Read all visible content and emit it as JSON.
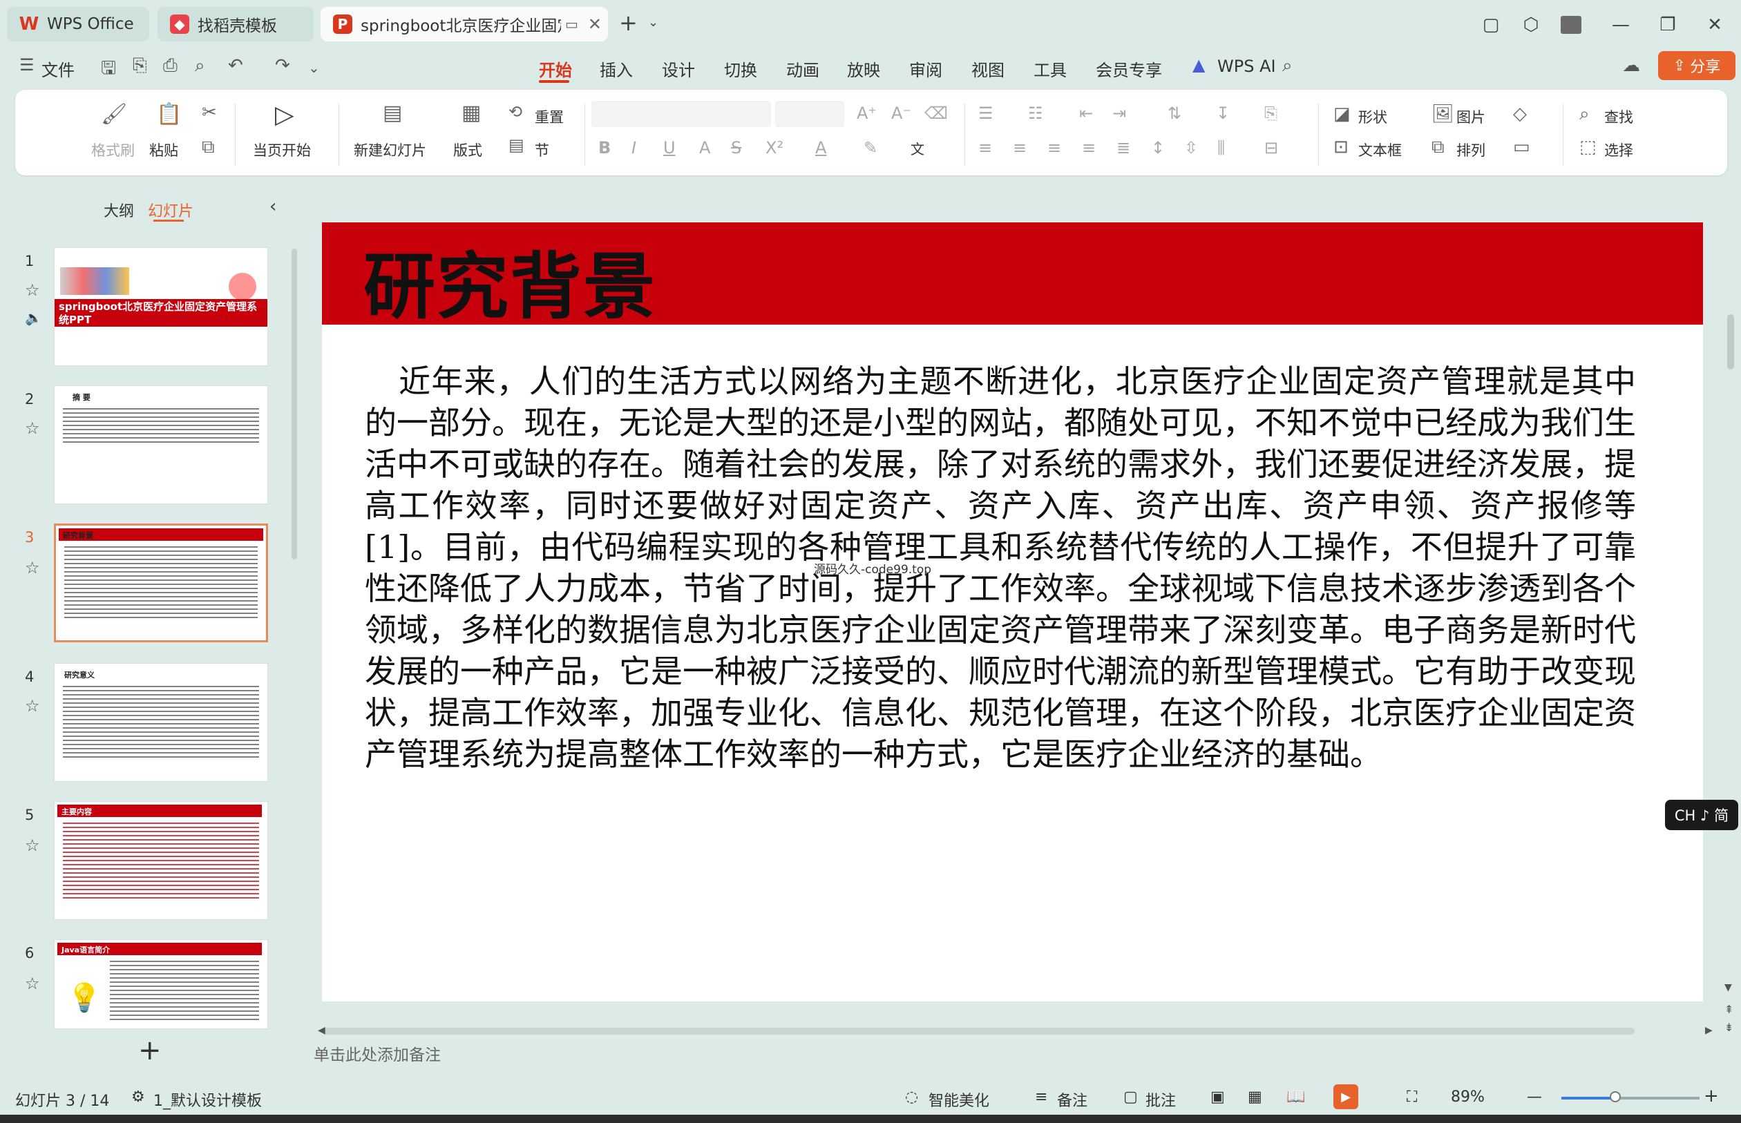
{
  "titlebar": {
    "tabs": [
      {
        "label": "WPS Office",
        "logo": "W"
      },
      {
        "label": "找稻壳模板",
        "logo": "◆"
      },
      {
        "label": "springboot北京医疗企业固定",
        "logo": "P"
      }
    ],
    "new_tab": "+"
  },
  "menu": {
    "file": "文件",
    "items": [
      "开始",
      "插入",
      "设计",
      "切换",
      "动画",
      "放映",
      "审阅",
      "视图",
      "工具",
      "会员专享",
      "WPS AI"
    ],
    "active": "开始",
    "share": "分享"
  },
  "ribbon": {
    "format_brush": "格式刷",
    "paste": "粘贴",
    "from_current": "当页开始",
    "new_slide": "新建幻灯片",
    "layout": "版式",
    "section": "节",
    "reset": "重置",
    "shape": "形状",
    "picture": "图片",
    "textbox": "文本框",
    "arrange": "排列",
    "find": "查找",
    "select": "选择"
  },
  "left_panel": {
    "tab_outline": "大纲",
    "tab_slides": "幻灯片",
    "slides": [
      {
        "num": "1",
        "title": "springboot北京医疗企业固定资产管理系统PPT"
      },
      {
        "num": "2",
        "title": "摘  要"
      },
      {
        "num": "3",
        "title": "研究背景"
      },
      {
        "num": "4",
        "title": "研究意义"
      },
      {
        "num": "5",
        "title": "主要内容"
      },
      {
        "num": "6",
        "title": "Java语言简介"
      }
    ],
    "current": "3"
  },
  "slide": {
    "title": "研究背景",
    "body": "近年来，人们的生活方式以网络为主题不断进化，北京医疗企业固定资产管理就是其中的一部分。现在，无论是大型的还是小型的网站，都随处可见，不知不觉中已经成为我们生活中不可或缺的存在。随着社会的发展，除了对系统的需求外，我们还要促进经济发展，提高工作效率，同时还要做好对固定资产、资产入库、资产出库、资产申领、资产报修等[1]。目前，由代码编程实现的各种管理工具和系统替代传统的人工操作，不但提升了可靠性还降低了人力成本，节省了时间，提升了工作效率。全球视域下信息技术逐步渗透到各个领域，多样化的数据信息为北京医疗企业固定资产管理带来了深刻变革。电子商务是新时代发展的一种产品，它是一种被广泛接受的、顺应时代潮流的新型管理模式。它有助于改变现状，提高工作效率，加强专业化、信息化、规范化管理，在这个阶段，北京医疗企业固定资产管理系统为提高整体工作效率的一种方式，它是医疗企业经济的基础。",
    "overlay_text": "源码久久-code99.top"
  },
  "ime": "CH ♪ 简",
  "notes_placeholder": "单击此处添加备注",
  "status": {
    "slide_info": "幻灯片 3 / 14",
    "template": "1_默认设计模板",
    "beautify": "智能美化",
    "notes": "备注",
    "comment": "批注",
    "zoom": "89%",
    "zoom_level": 0.39
  },
  "colors": {
    "accent": "#d9381e",
    "slide_red": "#c8000b",
    "share": "#e8632b"
  }
}
